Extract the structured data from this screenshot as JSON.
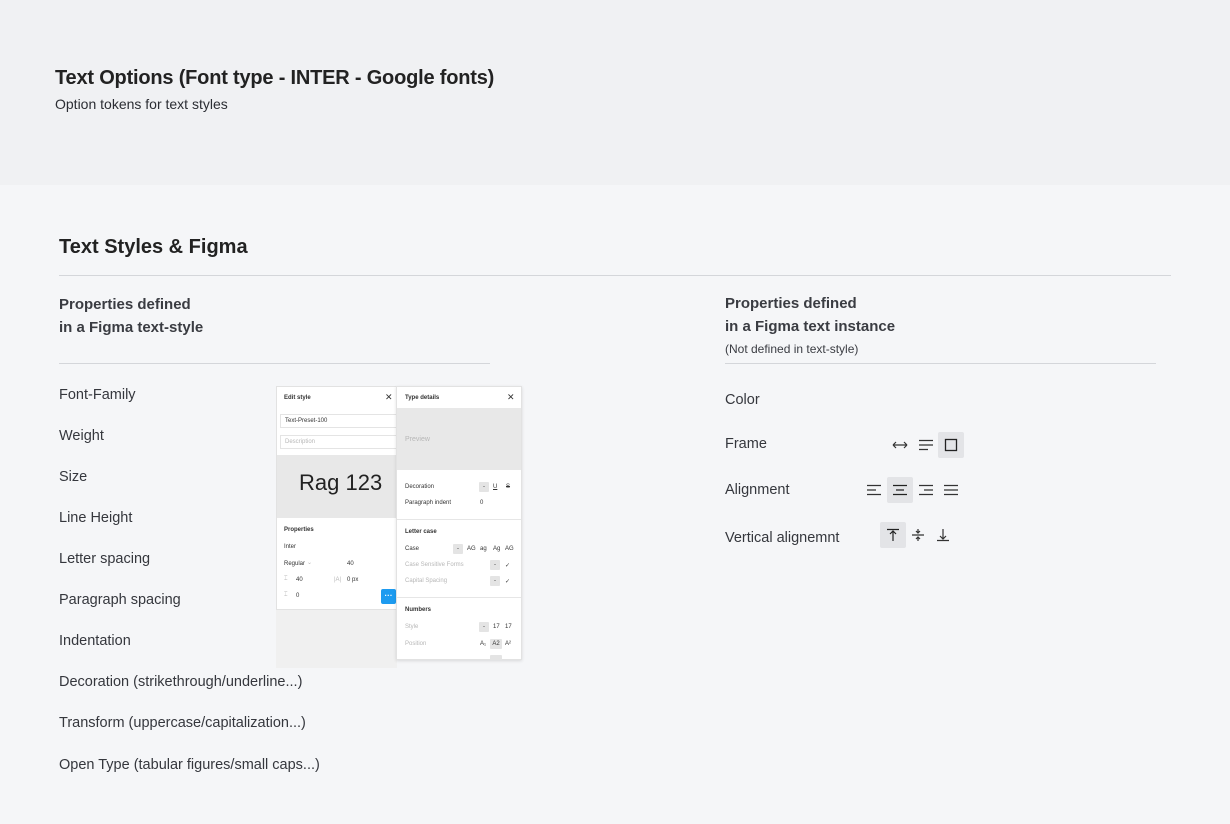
{
  "header": {
    "title": "Text Options  (Font type - INTER - Google fonts)",
    "subtitle": "Option tokens for text styles"
  },
  "section": {
    "title": "Text Styles & Figma"
  },
  "left": {
    "heading_line1": "Properties defined",
    "heading_line2": "in a Figma text-style",
    "items": [
      "Font-Family",
      "Weight",
      "Size",
      "Line Height",
      "Letter spacing",
      "Paragraph spacing",
      "Indentation",
      "Decoration (strikethrough/underline...)",
      "Transform (uppercase/capitalization...)",
      "Open Type (tabular figures/small caps...)"
    ]
  },
  "right": {
    "heading_line1": "Properties defined",
    "heading_line2": "in a Figma text instance",
    "note": "(Not defined in text-style)",
    "items": [
      "Color",
      "Frame",
      "Alignment",
      "Vertical alignemnt"
    ]
  },
  "figma": {
    "edit_style": {
      "title": "Edit style",
      "close": "✕",
      "name_value": "Text-Preset-100",
      "description_placeholder": "Description",
      "preview_text": "Rag 123",
      "properties_label": "Properties",
      "font_family": "Inter",
      "weight": "Regular",
      "weight_chevron": "⌄",
      "size": "40",
      "line_height_icon": "⌶",
      "line_height": "40",
      "letter_spacing_icon": "|A|",
      "letter_spacing": "0 px",
      "paragraph_icon": "⌶",
      "paragraph_spacing": "0",
      "more": "···"
    },
    "type_details": {
      "title": "Type details",
      "close": "✕",
      "preview": "Preview",
      "decoration_label": "Decoration",
      "decoration_opts": [
        "-",
        "U",
        "S"
      ],
      "paragraph_indent_label": "Paragraph indent",
      "paragraph_indent": "0",
      "letter_case_label": "Letter case",
      "case_label": "Case",
      "case_opts": [
        "-",
        "AG",
        "ag",
        "Ag",
        "AG"
      ],
      "case_sensitive_label": "Case Sensitive Forms",
      "capital_spacing_label": "Capital Spacing",
      "dash": "-",
      "check": "✓",
      "numbers_label": "Numbers",
      "style_label": "Style",
      "style_opts": [
        "-",
        "17",
        "17"
      ],
      "position_label": "Position",
      "position_opts": [
        "A₁",
        "A2",
        "A²"
      ]
    }
  }
}
